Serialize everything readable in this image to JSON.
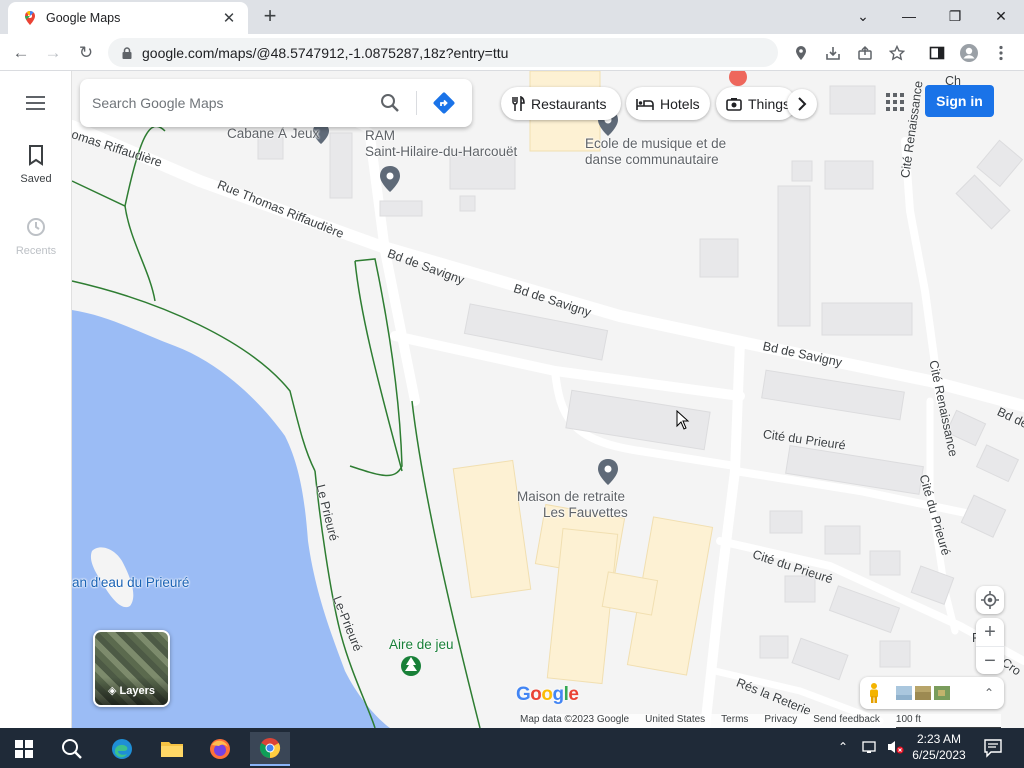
{
  "browser": {
    "tab_title": "Google Maps",
    "url": "google.com/maps/@48.5747912,-1.0875287,18z?entry=ttu",
    "accent_color": "#1a73e8"
  },
  "maps": {
    "search_placeholder": "Search Google Maps",
    "rail": {
      "saved_label": "Saved",
      "recents_label": "Recents"
    },
    "chips": [
      {
        "label": "Restaurants",
        "icon": "restaurant-icon"
      },
      {
        "label": "Hotels",
        "icon": "hotel-icon"
      },
      {
        "label": "Things",
        "icon": "camera-icon"
      }
    ],
    "signin_label": "Sign in",
    "layers_label": "Layers",
    "places": {
      "cabane": "Cabane À Jeux",
      "ram_line1": "RAM",
      "ram_line2": "Saint-Hilaire-du-Harcouët",
      "ecole_line1": "Ecole de musique et de",
      "ecole_line2": "danse communautaire",
      "maison_line1": "Maison de retraite",
      "maison_line2": "Les Fauvettes",
      "aire": "Aire de jeu",
      "plan_eau": "an d'eau du Prieuré"
    },
    "streets": {
      "riffaudiere_top": "omas Riffaudière",
      "riffaudiere": "Rue Thomas Riffaudière",
      "savigny_1": "Bd de Savigny",
      "savigny_2": "Bd de Savigny",
      "savigny_3": "Bd de Savigny",
      "savigny_cut": "Bd de",
      "cite_renaissance_top": "Cité Renaissance",
      "cite_renaissance": "Cité Renaissance",
      "cite_prieure_1": "Cité du Prieuré",
      "cite_prieure_2": "Cité du Prieuré",
      "cite_prieure_v": "Cité du Prieuré",
      "le_prieure_1": "Le Prieuré",
      "le_prieure_2": "Le-Prieuré",
      "res_reterie": "Rés la Reterie",
      "cro": "Cro",
      "r_cut": "R",
      "ch_cut": "Ch"
    },
    "footer": {
      "map_data": "Map data ©2023 Google",
      "country": "United States",
      "terms": "Terms",
      "privacy": "Privacy",
      "feedback": "Send feedback",
      "scale": "100 ft"
    }
  },
  "taskbar": {
    "time": "2:23 AM",
    "date": "6/25/2023"
  }
}
